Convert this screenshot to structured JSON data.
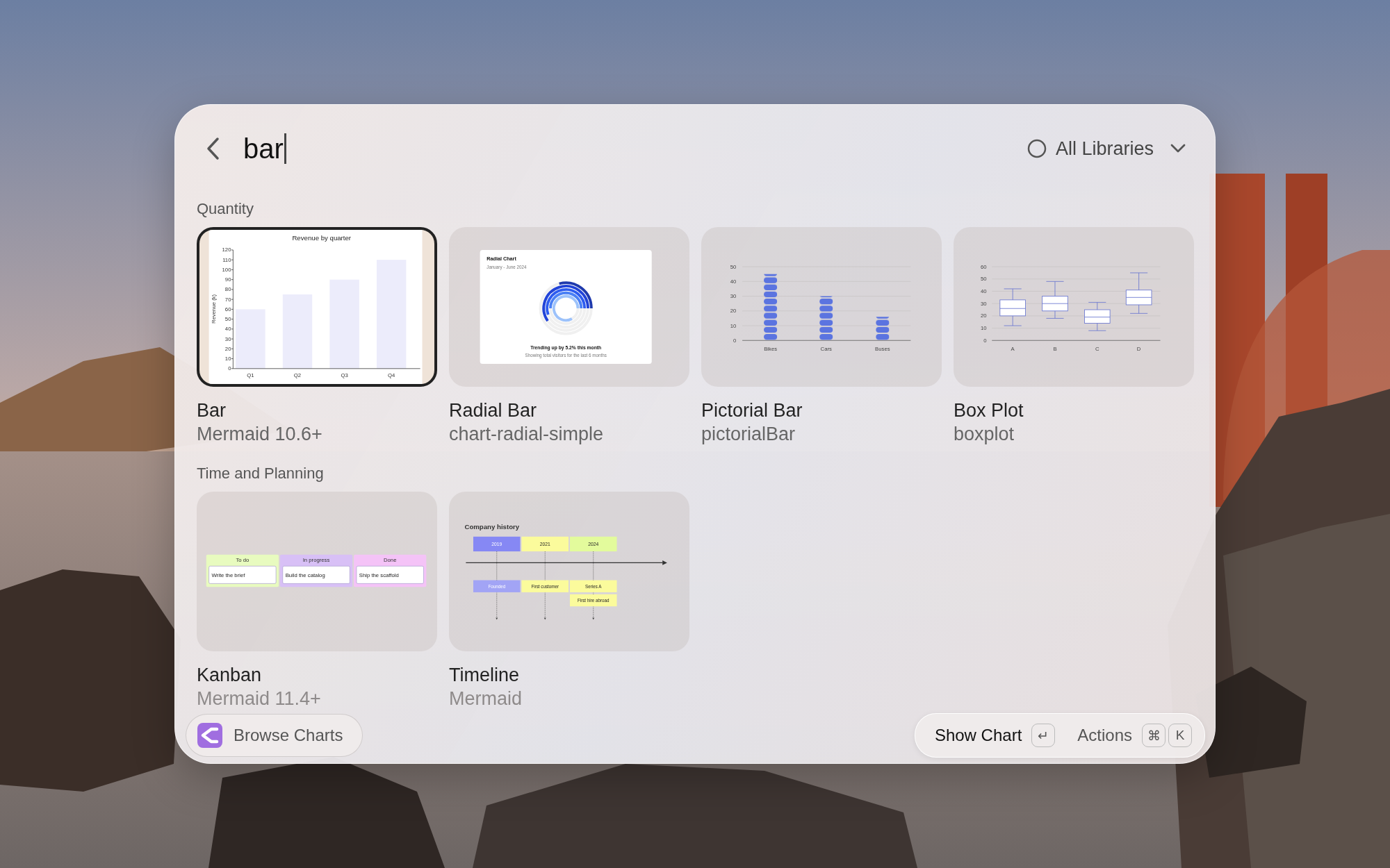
{
  "search": {
    "value": "bar"
  },
  "library_filter": {
    "label": "All Libraries"
  },
  "sections": [
    {
      "title": "Quantity",
      "items": [
        {
          "kind": "bar_chart",
          "title": "Bar",
          "subtitle": "Mermaid 10.6+",
          "selected": true,
          "chart_data": {
            "type": "bar",
            "title": "Revenue by quarter",
            "ylabel": "Revenue (k)",
            "categories": [
              "Q1",
              "Q2",
              "Q3",
              "Q4"
            ],
            "values": [
              60,
              75,
              90,
              110
            ],
            "ylim": [
              0,
              120
            ],
            "yticks": [
              0,
              10,
              20,
              30,
              40,
              50,
              60,
              70,
              80,
              90,
              100,
              110,
              120
            ]
          }
        },
        {
          "kind": "radial",
          "title": "Radial Bar",
          "subtitle": "chart-radial-simple",
          "selected": false,
          "preview": {
            "title": "Radial Chart",
            "subtitle": "January - June 2024",
            "trend": "Trending up by 5.2% this month",
            "footnote": "Showing total visitors for the last 6 months"
          }
        },
        {
          "kind": "pictorial_chart",
          "title": "Pictorial Bar",
          "subtitle": "pictorialBar",
          "selected": false,
          "chart_data": {
            "type": "bar",
            "categories": [
              "Bikes",
              "Cars",
              "Buses"
            ],
            "values": [
              45,
              30,
              16
            ],
            "ylim": [
              0,
              50
            ],
            "yticks": [
              0,
              10,
              20,
              30,
              40,
              50
            ],
            "grid": true
          }
        },
        {
          "kind": "box_chart",
          "title": "Box Plot",
          "subtitle": "boxplot",
          "selected": false,
          "chart_data": {
            "type": "box",
            "categories": [
              "A",
              "B",
              "C",
              "D"
            ],
            "ylim": [
              0,
              60
            ],
            "yticks": [
              0,
              10,
              20,
              30,
              40,
              50,
              60
            ],
            "grid": true,
            "boxes": [
              {
                "low": 12,
                "q1": 20,
                "median": 26,
                "q3": 33,
                "high": 42
              },
              {
                "low": 18,
                "q1": 24,
                "median": 30,
                "q3": 36,
                "high": 48
              },
              {
                "low": 8,
                "q1": 14,
                "median": 19,
                "q3": 25,
                "high": 31
              },
              {
                "low": 22,
                "q1": 29,
                "median": 35,
                "q3": 41,
                "high": 55
              }
            ]
          }
        }
      ]
    },
    {
      "title": "Time and Planning",
      "items": [
        {
          "kind": "kanban",
          "title": "Kanban",
          "subtitle": "Mermaid 11.4+",
          "selected": false,
          "columns": [
            {
              "title": "To do",
              "card": "Write the brief",
              "color": "#e8fbbf"
            },
            {
              "title": "In progress",
              "card": "Build the catalog",
              "color": "#d8c0f6"
            },
            {
              "title": "Done",
              "card": "Ship the scaffold",
              "color": "#f4c3f7"
            }
          ]
        },
        {
          "kind": "timeline",
          "title": "Timeline",
          "subtitle": "Mermaid",
          "selected": false,
          "heading": "Company history",
          "periods": [
            {
              "label": "2019",
              "color": "#8688f4",
              "events": [
                {
                  "label": "Founded",
                  "color": "#a2a4f5"
                }
              ]
            },
            {
              "label": "2021",
              "color": "#fbfb9c",
              "events": [
                {
                  "label": "First customer",
                  "color": "#fbfb9c"
                }
              ]
            },
            {
              "label": "2024",
              "color": "#e3fb9c",
              "events": [
                {
                  "label": "Series A",
                  "color": "#fbfb9c"
                },
                {
                  "label": "First hire abroad",
                  "color": "#fbfb9c"
                }
              ]
            }
          ]
        }
      ]
    }
  ],
  "footer": {
    "browse_label": "Browse Charts",
    "primary_action": {
      "label": "Show Chart",
      "key": "↵"
    },
    "secondary_action": {
      "label": "Actions",
      "keys": [
        "⌘",
        "K"
      ]
    }
  }
}
